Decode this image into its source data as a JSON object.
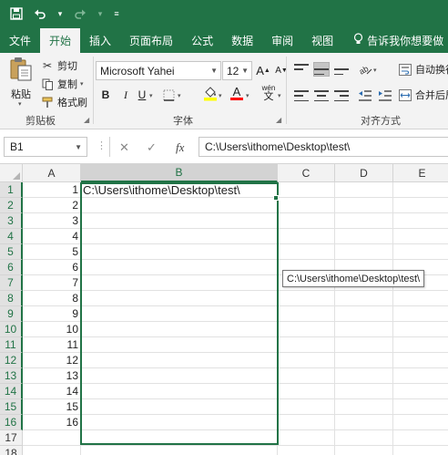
{
  "quick_access": {
    "save_icon": "save-icon",
    "undo_icon": "undo-icon",
    "redo_icon": "redo-icon"
  },
  "tabs": [
    {
      "label": "文件",
      "active": false
    },
    {
      "label": "开始",
      "active": true
    },
    {
      "label": "插入",
      "active": false
    },
    {
      "label": "页面布局",
      "active": false
    },
    {
      "label": "公式",
      "active": false
    },
    {
      "label": "数据",
      "active": false
    },
    {
      "label": "审阅",
      "active": false
    },
    {
      "label": "视图",
      "active": false
    }
  ],
  "tell_me": "告诉我你想要做",
  "clipboard": {
    "paste": "粘贴",
    "cut": "剪切",
    "copy": "复制",
    "format_painter": "格式刷",
    "group_label": "剪贴板"
  },
  "font": {
    "name": "Microsoft Yahei",
    "size": "12",
    "grow": "A",
    "shrink": "A",
    "bold": "B",
    "italic": "I",
    "underline": "U",
    "font_color": "A",
    "phonetic": "wén",
    "group_label": "字体"
  },
  "alignment": {
    "wrap_text": "自动换行",
    "merge_center": "合并后居",
    "group_label": "对齐方式"
  },
  "formula_bar": {
    "name_box": "B1",
    "cancel": "✕",
    "enter": "✓",
    "fx": "fx",
    "value": "C:\\Users\\ithome\\Desktop\\test\\"
  },
  "columns": [
    "A",
    "B",
    "C",
    "D",
    "E"
  ],
  "rows": [
    {
      "row": "1",
      "a": "1",
      "b": "C:\\Users\\ithome\\Desktop\\test\\"
    },
    {
      "row": "2",
      "a": "2",
      "b": ""
    },
    {
      "row": "3",
      "a": "3",
      "b": ""
    },
    {
      "row": "4",
      "a": "4",
      "b": ""
    },
    {
      "row": "5",
      "a": "5",
      "b": ""
    },
    {
      "row": "6",
      "a": "6",
      "b": ""
    },
    {
      "row": "7",
      "a": "7",
      "b": ""
    },
    {
      "row": "8",
      "a": "8",
      "b": ""
    },
    {
      "row": "9",
      "a": "9",
      "b": ""
    },
    {
      "row": "10",
      "a": "10",
      "b": ""
    },
    {
      "row": "11",
      "a": "11",
      "b": ""
    },
    {
      "row": "12",
      "a": "12",
      "b": ""
    },
    {
      "row": "13",
      "a": "13",
      "b": ""
    },
    {
      "row": "14",
      "a": "14",
      "b": ""
    },
    {
      "row": "15",
      "a": "15",
      "b": ""
    },
    {
      "row": "16",
      "a": "16",
      "b": ""
    },
    {
      "row": "17",
      "a": "",
      "b": ""
    },
    {
      "row": "18",
      "a": "",
      "b": ""
    }
  ],
  "tooltip": "C:\\Users\\ithome\\Desktop\\test\\",
  "colors": {
    "accent": "#217346",
    "highlight_yellow": "#ffff00",
    "font_red": "#ff0000"
  }
}
